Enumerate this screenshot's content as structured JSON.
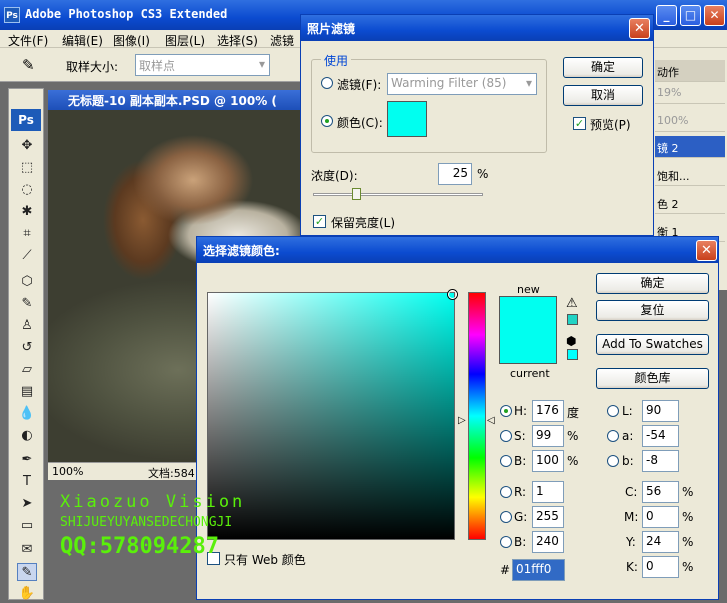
{
  "app": {
    "title": "Adobe Photoshop CS3 Extended",
    "logo": "Ps"
  },
  "menu": [
    "文件(F)",
    "编辑(E)",
    "图像(I)",
    "图层(L)",
    "选择(S)",
    "滤镜"
  ],
  "options": {
    "sample_label": "取样大小:",
    "sample_value": "取样点"
  },
  "document": {
    "title": "无标题-10 副本副本.PSD @ 100% (",
    "zoom": "100%",
    "status": "文档:584"
  },
  "panel": {
    "tab": "动作",
    "rows": [
      "19%",
      "100%",
      "镜 2",
      "饱和...",
      "色 2",
      "衡 1"
    ]
  },
  "photo_filter": {
    "title": "照片滤镜",
    "group": "使用",
    "filter_label": "滤镜(F):",
    "filter_value": "Warming Filter (85)",
    "color_label": "颜色(C):",
    "swatch": "#00fff0",
    "ok": "确定",
    "cancel": "取消",
    "preview": "预览(P)",
    "density_label": "浓度(D):",
    "density_value": "25",
    "density_unit": "%",
    "density_level": 0.25,
    "preserve": "保留亮度(L)"
  },
  "picker": {
    "title": "选择滤镜颜色:",
    "new_label": "new",
    "current_label": "current",
    "new_color": "#00fff0",
    "current_color": "#00fff0",
    "ok": "确定",
    "reset": "复位",
    "add_swatches": "Add To Swatches",
    "libraries": "颜色库",
    "only_web": "只有 Web 颜色",
    "hsb": [
      {
        "label": "H:",
        "value": "176",
        "unit": "度"
      },
      {
        "label": "S:",
        "value": "99",
        "unit": "%"
      },
      {
        "label": "B:",
        "value": "100",
        "unit": "%"
      }
    ],
    "rgb": [
      {
        "label": "R:",
        "value": "1"
      },
      {
        "label": "G:",
        "value": "255"
      },
      {
        "label": "B:",
        "value": "240"
      }
    ],
    "lab": [
      {
        "label": "L:",
        "value": "90"
      },
      {
        "label": "a:",
        "value": "-54"
      },
      {
        "label": "b:",
        "value": "-8"
      }
    ],
    "cmyk": [
      {
        "label": "C:",
        "value": "56",
        "unit": "%"
      },
      {
        "label": "M:",
        "value": "0",
        "unit": "%"
      },
      {
        "label": "Y:",
        "value": "24",
        "unit": "%"
      },
      {
        "label": "K:",
        "value": "0",
        "unit": "%"
      }
    ],
    "hex_label": "#",
    "hex": "01fff0"
  },
  "watermark": {
    "line1": "Xiaozuo Vision",
    "line2": "SHIJUEYUYANSEDECHONGJI",
    "line3": "QQ:578094287",
    "color": "#5af00a"
  }
}
